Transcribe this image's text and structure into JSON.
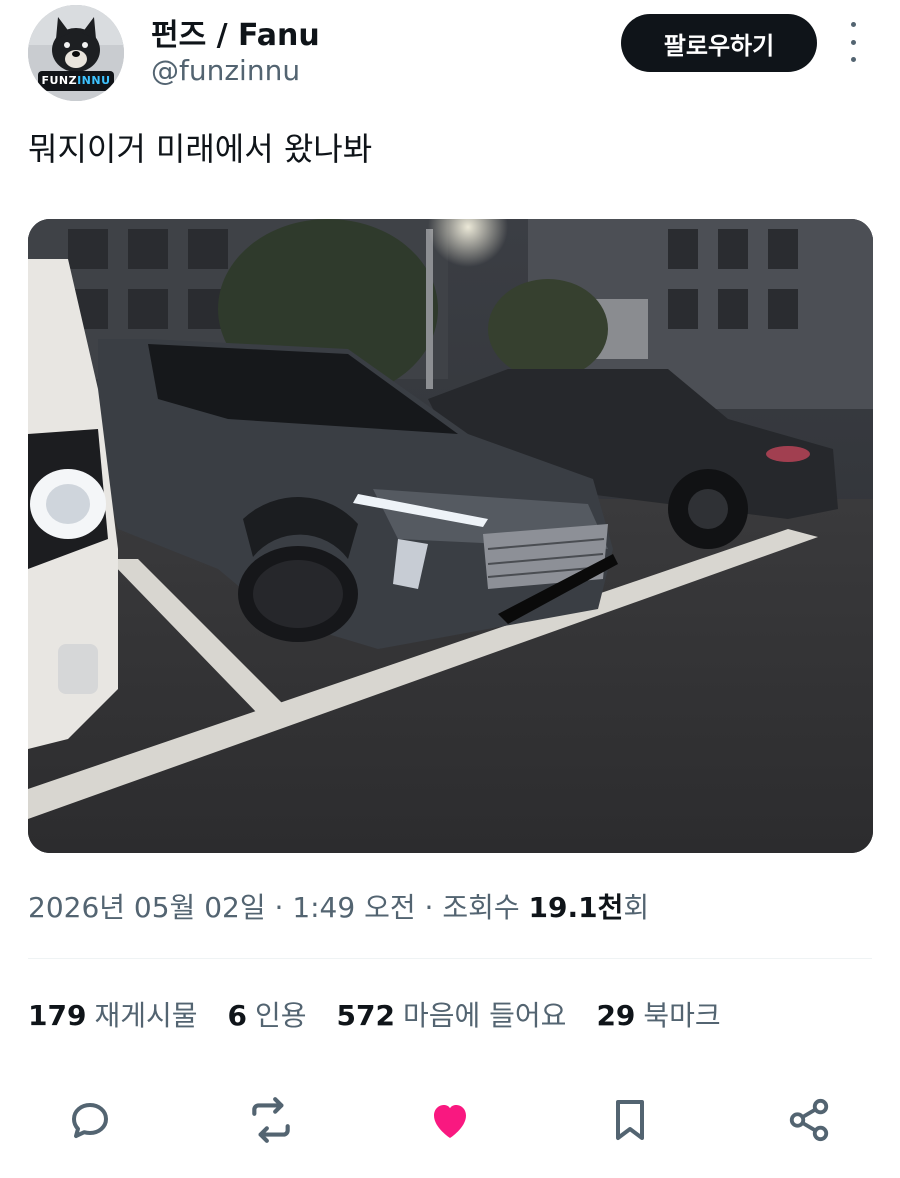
{
  "author": {
    "display_name": "펀즈 / Fanu",
    "handle": "@funzinnu",
    "avatar_badge_part1": "FUNZ",
    "avatar_badge_part2": "INNU"
  },
  "follow_button": {
    "label": "팔로우하기"
  },
  "more_icon": "more-vertical-icon",
  "tweet": {
    "text": "뭐지이거 미래에서 왔나봐",
    "photo_icon": "photo"
  },
  "meta": {
    "date": "2026년 05월 02일",
    "sep1": " · ",
    "time": "1:49 오전",
    "sep2": " · ",
    "views_label": "조회수 ",
    "views_value": "19.1천",
    "views_suffix": "회"
  },
  "stats": [
    {
      "count": "179",
      "label": "재게시물"
    },
    {
      "count": "6",
      "label": "인용"
    },
    {
      "count": "572",
      "label": "마음에 들어요"
    },
    {
      "count": "29",
      "label": "북마크"
    }
  ],
  "actions": [
    {
      "name": "reply",
      "icon": "reply-icon"
    },
    {
      "name": "repost",
      "icon": "repost-icon"
    },
    {
      "name": "like",
      "icon": "heart-icon",
      "active": true,
      "color": "#f91880"
    },
    {
      "name": "bookmark",
      "icon": "bookmark-icon"
    },
    {
      "name": "share",
      "icon": "share-icon"
    }
  ],
  "colors": {
    "text_primary": "#0f1419",
    "text_secondary": "#536471",
    "like_active": "#f91880",
    "follow_bg": "#0f1419"
  }
}
